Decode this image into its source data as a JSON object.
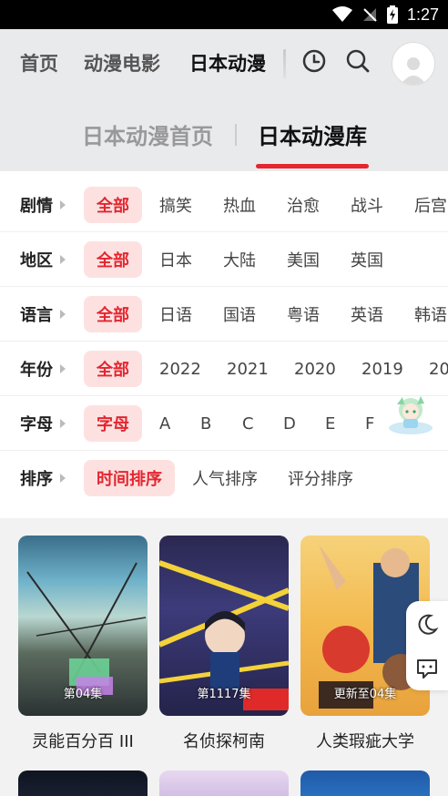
{
  "status_bar": {
    "time": "1:27"
  },
  "top_nav": {
    "tabs": [
      {
        "label": "首页"
      },
      {
        "label": "动漫电影"
      },
      {
        "label": "日本动漫"
      }
    ]
  },
  "sub_tabs": [
    {
      "label": "日本动漫首页"
    },
    {
      "label": "日本动漫库"
    }
  ],
  "filters": [
    {
      "label": "剧情",
      "options": [
        "全部",
        "搞笑",
        "热血",
        "治愈",
        "战斗",
        "后宫"
      ]
    },
    {
      "label": "地区",
      "options": [
        "全部",
        "日本",
        "大陆",
        "美国",
        "英国"
      ]
    },
    {
      "label": "语言",
      "options": [
        "全部",
        "日语",
        "国语",
        "粤语",
        "英语",
        "韩语"
      ]
    },
    {
      "label": "年份",
      "options": [
        "全部",
        "2022",
        "2021",
        "2020",
        "2019",
        "20"
      ]
    },
    {
      "label": "字母",
      "options": [
        "字母",
        "A",
        "B",
        "C",
        "D",
        "E",
        "F"
      ]
    },
    {
      "label": "排序",
      "options": [
        "时间排序",
        "人气排序",
        "评分排序"
      ]
    }
  ],
  "cards": [
    {
      "title": "灵能百分百 III",
      "badge": "第04集"
    },
    {
      "title": "名侦探柯南",
      "badge": "第1117集"
    },
    {
      "title": "人类瑕疵大学",
      "badge": "更新至04集"
    }
  ],
  "colors": {
    "accent": "#e3262f",
    "active_bg": "#fde1e1",
    "highlight": "#f5c242"
  },
  "icons": [
    "wifi-icon",
    "signal-icon",
    "battery-icon",
    "history-icon",
    "search-icon",
    "avatar-icon",
    "moon-icon",
    "feedback-icon"
  ]
}
